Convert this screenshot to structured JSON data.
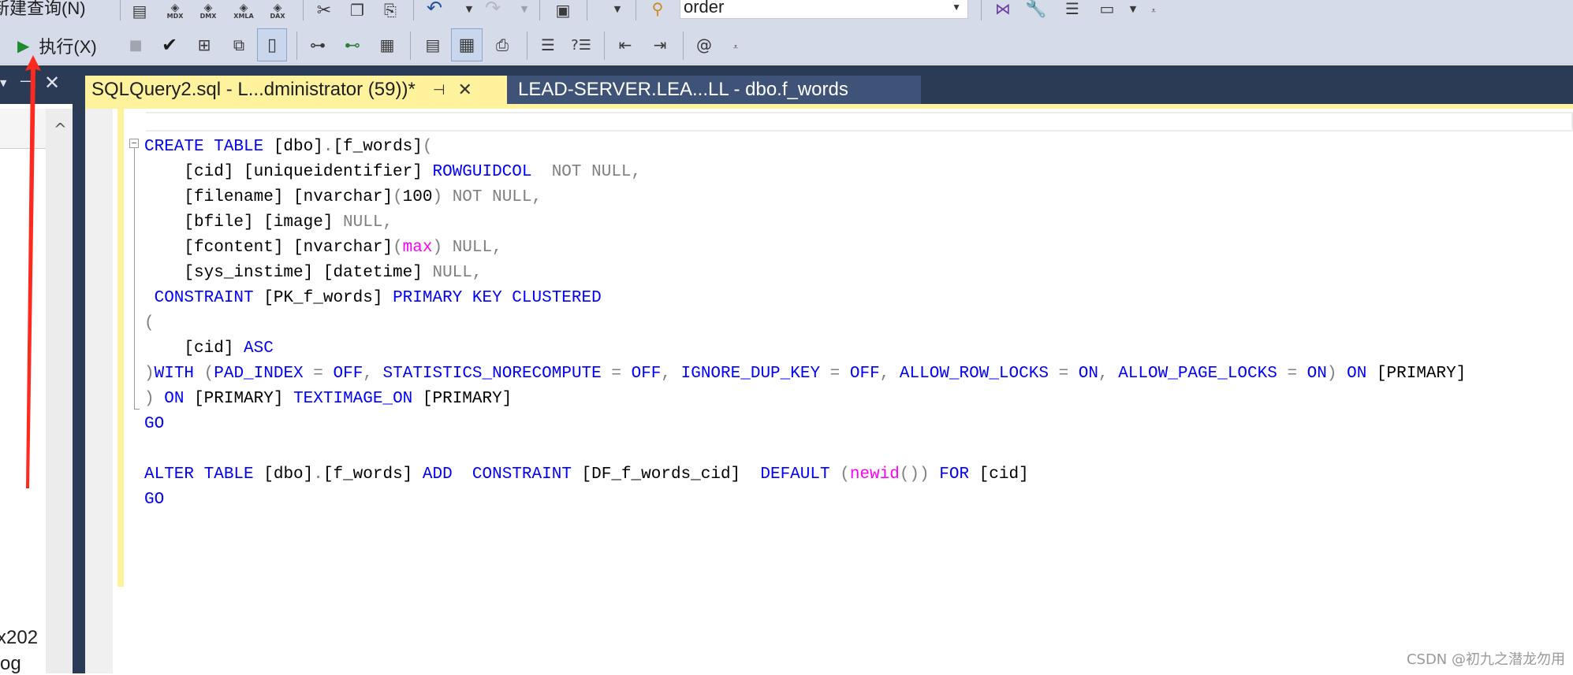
{
  "toolbar": {
    "new_query_label": "新建查询(N)",
    "mdx_label": "MDX",
    "dmx_label": "DMX",
    "xmla_label": "XMLA",
    "dax_label": "DAX",
    "database_value": "order",
    "execute_label": "执行(X)"
  },
  "tabs": [
    {
      "title": "SQLQuery2.sql - L...dministrator (59))*",
      "pin": "⊣",
      "close": "✕",
      "active": true
    },
    {
      "title": "LEAD-SERVER.LEA...LL - dbo.f_words",
      "active": false
    }
  ],
  "left_panel": {
    "pin_icon": "⊣",
    "close_icon": "✕",
    "scroll_up": "^",
    "item_1": "x202",
    "item_2": "og"
  },
  "editor": {
    "lines": [
      [
        {
          "t": "CREATE TABLE ",
          "c": "kw"
        },
        {
          "t": "[dbo]",
          "c": ""
        },
        {
          "t": ".",
          "c": "gr"
        },
        {
          "t": "[f_words]",
          "c": ""
        },
        {
          "t": "(",
          "c": "gr"
        }
      ],
      [
        {
          "t": "    [cid] [uniqueidentifier] ",
          "c": ""
        },
        {
          "t": "ROWGUIDCOL",
          "c": "kw"
        },
        {
          "t": "  NOT NULL,",
          "c": "gr"
        }
      ],
      [
        {
          "t": "    [filename] [nvarchar]",
          "c": ""
        },
        {
          "t": "(",
          "c": "gr"
        },
        {
          "t": "100",
          "c": ""
        },
        {
          "t": ") NOT NULL,",
          "c": "gr"
        }
      ],
      [
        {
          "t": "    [bfile] [image] ",
          "c": ""
        },
        {
          "t": "NULL,",
          "c": "gr"
        }
      ],
      [
        {
          "t": "    [fcontent] [nvarchar]",
          "c": ""
        },
        {
          "t": "(",
          "c": "gr"
        },
        {
          "t": "max",
          "c": "fn"
        },
        {
          "t": ") NULL,",
          "c": "gr"
        }
      ],
      [
        {
          "t": "    [sys_instime] [datetime] ",
          "c": ""
        },
        {
          "t": "NULL,",
          "c": "gr"
        }
      ],
      [
        {
          "t": " CONSTRAINT ",
          "c": "kw"
        },
        {
          "t": "[PK_f_words] ",
          "c": ""
        },
        {
          "t": "PRIMARY KEY CLUSTERED",
          "c": "kw"
        }
      ],
      [
        {
          "t": "(",
          "c": "gr"
        }
      ],
      [
        {
          "t": "    [cid] ",
          "c": ""
        },
        {
          "t": "ASC",
          "c": "kw"
        }
      ],
      [
        {
          "t": ")",
          "c": "gr"
        },
        {
          "t": "WITH ",
          "c": "kw"
        },
        {
          "t": "(",
          "c": "gr"
        },
        {
          "t": "PAD_INDEX ",
          "c": "kw"
        },
        {
          "t": "= ",
          "c": "gr"
        },
        {
          "t": "OFF",
          "c": "kw"
        },
        {
          "t": ", ",
          "c": "gr"
        },
        {
          "t": "STATISTICS_NORECOMPUTE ",
          "c": "kw"
        },
        {
          "t": "= ",
          "c": "gr"
        },
        {
          "t": "OFF",
          "c": "kw"
        },
        {
          "t": ", ",
          "c": "gr"
        },
        {
          "t": "IGNORE_DUP_KEY ",
          "c": "kw"
        },
        {
          "t": "= ",
          "c": "gr"
        },
        {
          "t": "OFF",
          "c": "kw"
        },
        {
          "t": ", ",
          "c": "gr"
        },
        {
          "t": "ALLOW_ROW_LOCKS ",
          "c": "kw"
        },
        {
          "t": "= ",
          "c": "gr"
        },
        {
          "t": "ON",
          "c": "kw"
        },
        {
          "t": ", ",
          "c": "gr"
        },
        {
          "t": "ALLOW_PAGE_LOCKS ",
          "c": "kw"
        },
        {
          "t": "= ",
          "c": "gr"
        },
        {
          "t": "ON",
          "c": "kw"
        },
        {
          "t": ") ",
          "c": "gr"
        },
        {
          "t": "ON ",
          "c": "kw"
        },
        {
          "t": "[PRIMARY]",
          "c": ""
        }
      ],
      [
        {
          "t": ") ",
          "c": "gr"
        },
        {
          "t": "ON ",
          "c": "kw"
        },
        {
          "t": "[PRIMARY] ",
          "c": ""
        },
        {
          "t": "TEXTIMAGE_ON ",
          "c": "kw"
        },
        {
          "t": "[PRIMARY]",
          "c": ""
        }
      ],
      [
        {
          "t": "GO",
          "c": "kw"
        }
      ],
      [
        {
          "t": "",
          "c": ""
        }
      ],
      [
        {
          "t": "ALTER TABLE ",
          "c": "kw"
        },
        {
          "t": "[dbo]",
          "c": ""
        },
        {
          "t": ".",
          "c": "gr"
        },
        {
          "t": "[f_words] ",
          "c": ""
        },
        {
          "t": "ADD  CONSTRAINT ",
          "c": "kw"
        },
        {
          "t": "[DF_f_words_cid]  ",
          "c": ""
        },
        {
          "t": "DEFAULT ",
          "c": "kw"
        },
        {
          "t": "(",
          "c": "gr"
        },
        {
          "t": "newid",
          "c": "fn"
        },
        {
          "t": "()) ",
          "c": "gr"
        },
        {
          "t": "FOR ",
          "c": "kw"
        },
        {
          "t": "[cid]",
          "c": ""
        }
      ],
      [
        {
          "t": "GO",
          "c": "kw"
        }
      ]
    ]
  },
  "watermark": "CSDN @初九之潜龙勿用",
  "colors": {
    "keyword": "#0000ff",
    "operator": "#808080",
    "function": "#ff00ff",
    "tab_active": "#fff29d",
    "tab_strip": "#2b3a55",
    "annotation_arrow": "#ff2a1f"
  }
}
